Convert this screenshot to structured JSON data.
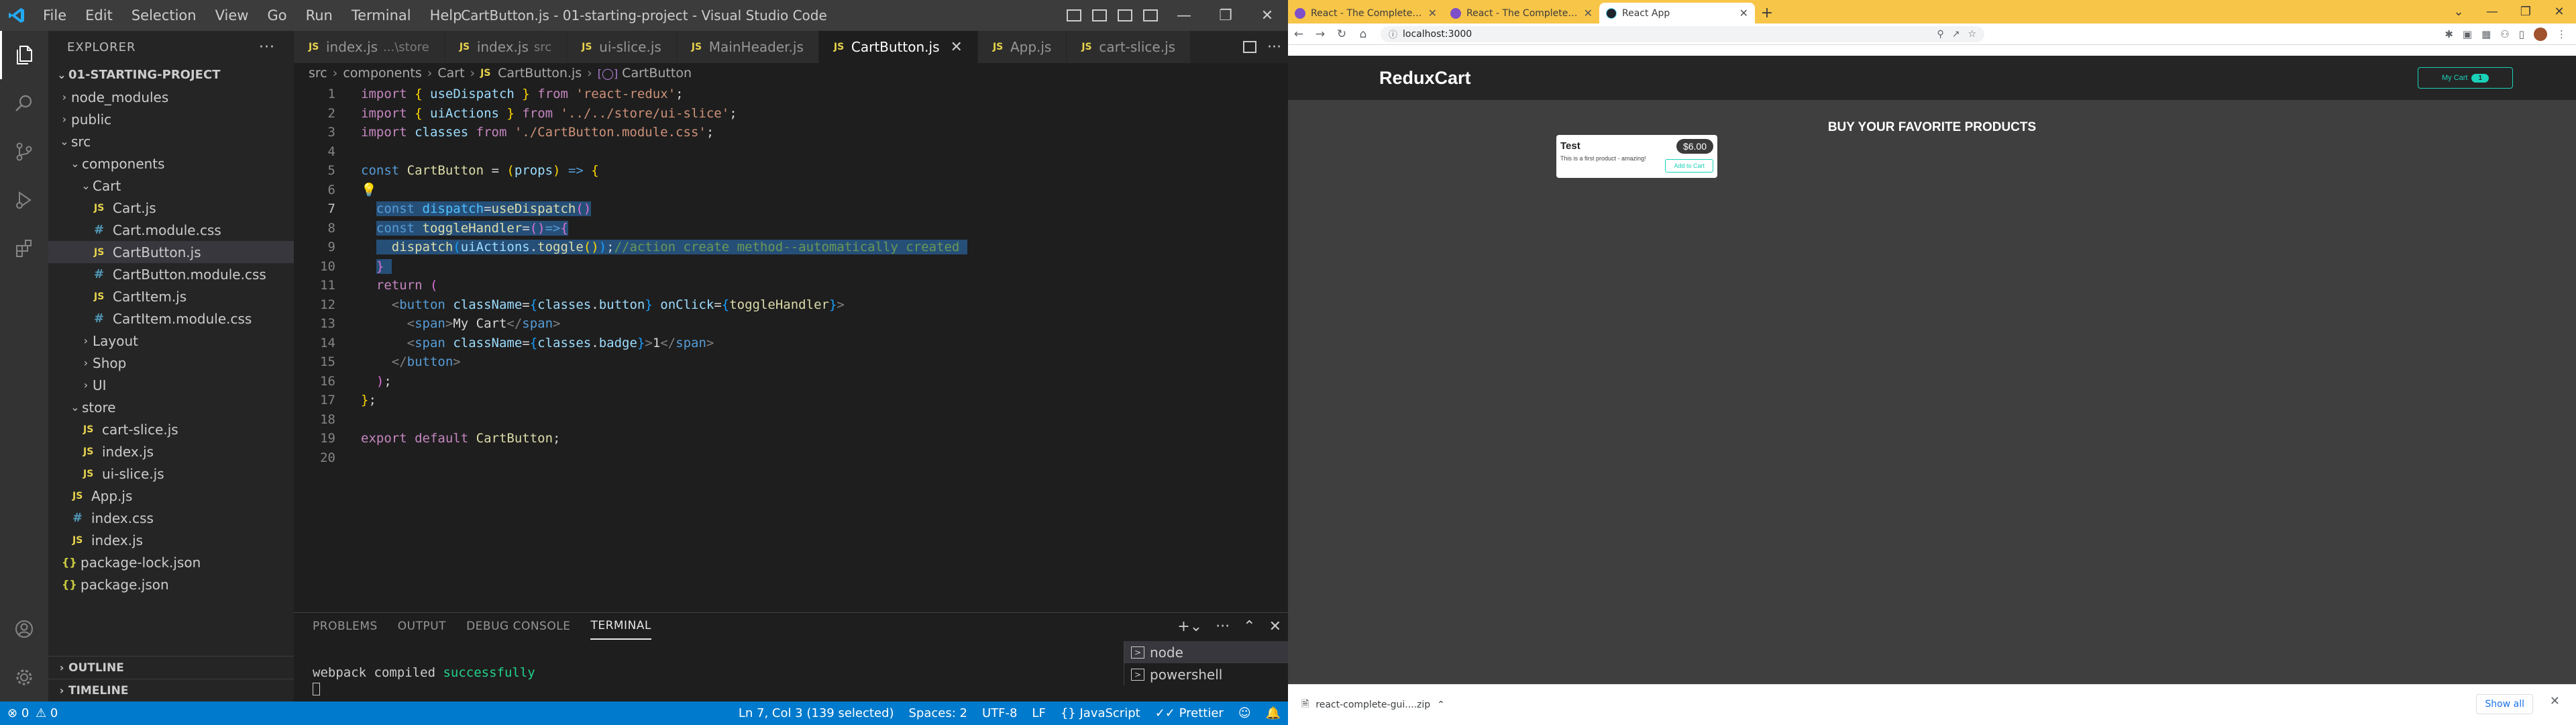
{
  "vscode": {
    "title": "CartButton.js - 01-starting-project - Visual Studio Code",
    "menu": [
      "File",
      "Edit",
      "Selection",
      "View",
      "Go",
      "Run",
      "Terminal",
      "Help"
    ],
    "sidebar": {
      "header": "EXPLORER",
      "project": "01-STARTING-PROJECT",
      "tree": [
        {
          "label": "node_modules",
          "type": "folder",
          "depth": 1,
          "open": false
        },
        {
          "label": "public",
          "type": "folder",
          "depth": 1,
          "open": false
        },
        {
          "label": "src",
          "type": "folder",
          "depth": 1,
          "open": true
        },
        {
          "label": "components",
          "type": "folder",
          "depth": 2,
          "open": true
        },
        {
          "label": "Cart",
          "type": "folder",
          "depth": 3,
          "open": true
        },
        {
          "label": "Cart.js",
          "type": "js",
          "depth": 4
        },
        {
          "label": "Cart.module.css",
          "type": "css",
          "depth": 4
        },
        {
          "label": "CartButton.js",
          "type": "js",
          "depth": 4,
          "selected": true
        },
        {
          "label": "CartButton.module.css",
          "type": "css",
          "depth": 4
        },
        {
          "label": "CartItem.js",
          "type": "js",
          "depth": 4
        },
        {
          "label": "CartItem.module.css",
          "type": "css",
          "depth": 4
        },
        {
          "label": "Layout",
          "type": "folder",
          "depth": 3,
          "open": false
        },
        {
          "label": "Shop",
          "type": "folder",
          "depth": 3,
          "open": false
        },
        {
          "label": "UI",
          "type": "folder",
          "depth": 3,
          "open": false
        },
        {
          "label": "store",
          "type": "folder",
          "depth": 2,
          "open": true
        },
        {
          "label": "cart-slice.js",
          "type": "js",
          "depth": 3
        },
        {
          "label": "index.js",
          "type": "js",
          "depth": 3
        },
        {
          "label": "ui-slice.js",
          "type": "js",
          "depth": 3
        },
        {
          "label": "App.js",
          "type": "js",
          "depth": 2
        },
        {
          "label": "index.css",
          "type": "css",
          "depth": 2
        },
        {
          "label": "index.js",
          "type": "js",
          "depth": 2
        },
        {
          "label": "package-lock.json",
          "type": "json",
          "depth": 1
        },
        {
          "label": "package.json",
          "type": "json",
          "depth": 1
        }
      ],
      "outline": "OUTLINE",
      "timeline": "TIMELINE"
    },
    "tabs": [
      {
        "label": "index.js",
        "desc": "...\\store",
        "icon": "JS"
      },
      {
        "label": "index.js",
        "desc": "src",
        "icon": "JS"
      },
      {
        "label": "ui-slice.js",
        "desc": "",
        "icon": "JS"
      },
      {
        "label": "MainHeader.js",
        "desc": "",
        "icon": "JS"
      },
      {
        "label": "CartButton.js",
        "desc": "",
        "icon": "JS",
        "active": true
      },
      {
        "label": "App.js",
        "desc": "",
        "icon": "JS"
      },
      {
        "label": "cart-slice.js",
        "desc": "",
        "icon": "JS"
      }
    ],
    "breadcrumb": [
      "src",
      "components",
      "Cart",
      "CartButton.js",
      "CartButton"
    ],
    "panel": {
      "tabs": [
        "PROBLEMS",
        "OUTPUT",
        "DEBUG CONSOLE",
        "TERMINAL"
      ],
      "active_tab": "TERMINAL",
      "output_prefix": "webpack compiled ",
      "output_status": "successfully",
      "terminals": [
        "node",
        "powershell"
      ]
    },
    "status": {
      "errors": "0",
      "warnings": "0",
      "position": "Ln 7, Col 3 (139 selected)",
      "spaces": "Spaces: 2",
      "encoding": "UTF-8",
      "eol": "LF",
      "language": "JavaScript",
      "formatter": "Prettier"
    }
  },
  "chrome": {
    "tabs": [
      {
        "title": "React - The Complete Guide (incl...",
        "active": false
      },
      {
        "title": "React - The Complete Guide (incl...",
        "active": false
      },
      {
        "title": "React App",
        "active": true
      }
    ],
    "url": "localhost:3000",
    "download": {
      "filename": "react-complete-gui....zip",
      "show_all": "Show all"
    }
  },
  "app": {
    "logo": "ReduxCart",
    "cart_button_label": "My Cart",
    "cart_badge": "1",
    "section_title": "BUY YOUR FAVORITE PRODUCTS",
    "product": {
      "title": "Test",
      "price": "$6.00",
      "description": "This is a first product - amazing!",
      "add_label": "Add to Cart"
    }
  }
}
